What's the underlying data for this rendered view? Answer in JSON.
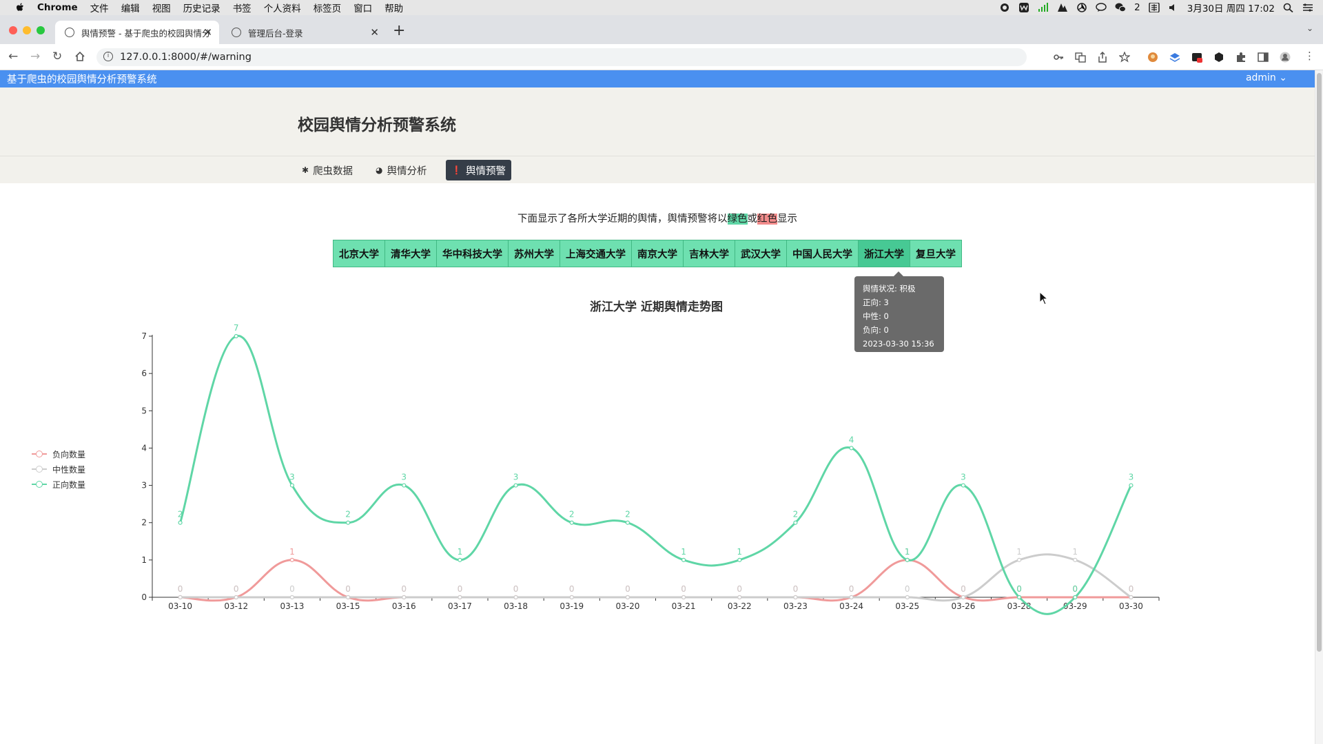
{
  "menubar": {
    "app": "Chrome",
    "items": [
      "文件",
      "编辑",
      "视图",
      "历史记录",
      "书签",
      "个人资料",
      "标签页",
      "窗口",
      "帮助"
    ],
    "badge_count": "2",
    "datetime": "3月30日 周四 17:02"
  },
  "browser": {
    "tabs": [
      {
        "title": "舆情预警 - 基于爬虫的校园舆情分"
      },
      {
        "title": "管理后台-登录"
      }
    ],
    "url": "127.0.0.1:8000/#/warning"
  },
  "app": {
    "header_title": "基于爬虫的校园舆情分析预警系统",
    "user": "admin",
    "hero_title": "校园舆情分析预警系统",
    "nav": [
      {
        "label": "爬虫数据",
        "icon": "spider-icon"
      },
      {
        "label": "舆情分析",
        "icon": "pie-icon"
      },
      {
        "label": "舆情预警",
        "icon": "alert-icon"
      }
    ],
    "notice": {
      "before": "下面显示了各所大学近期的舆情，舆情预警将以",
      "green": "绿色",
      "middle": "或",
      "red": "红色",
      "after": "显示"
    },
    "universities": [
      "北京大学",
      "清华大学",
      "华中科技大学",
      "苏州大学",
      "上海交通大学",
      "南京大学",
      "吉林大学",
      "武汉大学",
      "中国人民大学",
      "浙江大学",
      "复旦大学"
    ],
    "selected_university": "浙江大学",
    "tooltip": {
      "status": "舆情状况: 积极",
      "pos": "正向: 3",
      "neu": "中性: 0",
      "neg": "负向: 0",
      "time": "2023-03-30 15:36"
    }
  },
  "colors": {
    "positive": "#5fd6a6",
    "neutral": "#cccccc",
    "negative": "#f09a9a",
    "header": "#4a90f0"
  },
  "chart_data": {
    "type": "line",
    "title": "浙江大学 近期舆情走势图",
    "x": [
      "03-10",
      "03-12",
      "03-13",
      "03-15",
      "03-16",
      "03-17",
      "03-18",
      "03-19",
      "03-20",
      "03-21",
      "03-22",
      "03-23",
      "03-24",
      "03-25",
      "03-26",
      "03-28",
      "03-29",
      "03-30"
    ],
    "series": [
      {
        "name": "负向数量",
        "color": "#f09a9a",
        "values": [
          0,
          0,
          1,
          0,
          0,
          0,
          0,
          0,
          0,
          0,
          0,
          0,
          0,
          1,
          0,
          0,
          0,
          0
        ]
      },
      {
        "name": "中性数量",
        "color": "#cccccc",
        "values": [
          0,
          0,
          0,
          0,
          0,
          0,
          0,
          0,
          0,
          0,
          0,
          0,
          0,
          0,
          0,
          1,
          1,
          0
        ]
      },
      {
        "name": "正向数量",
        "color": "#5fd6a6",
        "values": [
          2,
          7,
          3,
          2,
          3,
          1,
          3,
          2,
          2,
          1,
          1,
          2,
          4,
          1,
          3,
          0,
          0,
          3
        ]
      }
    ],
    "ylim": [
      0,
      7
    ],
    "yticks": [
      0,
      1,
      2,
      3,
      4,
      5,
      6,
      7
    ],
    "smooth": true,
    "legend": "left"
  }
}
